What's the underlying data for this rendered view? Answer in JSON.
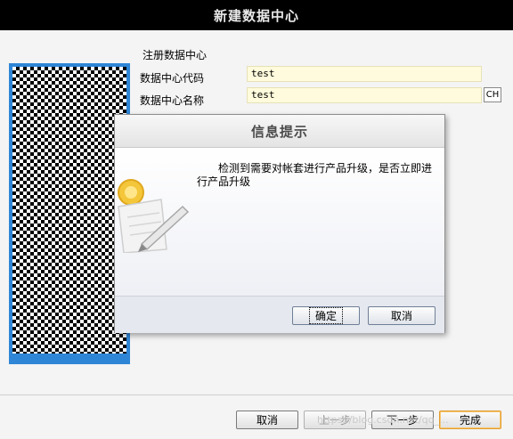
{
  "window": {
    "title": "新建数据中心"
  },
  "form": {
    "section_title": "注册数据中心",
    "code_label": "数据中心代码",
    "code_value": "test",
    "name_label": "数据中心名称",
    "name_value": "test",
    "lang_button": "CH"
  },
  "wizard": {
    "cancel": "取消",
    "prev": "上一步",
    "next": "下一步",
    "finish": "完成",
    "watermark": "https://blog.csdn.net/qq_..."
  },
  "dialog": {
    "title": "信息提示",
    "icon": "note-pencil-icon",
    "message": "检测到需要对帐套进行产品升级，是否立即进行产品升级",
    "ok": "确定",
    "cancel": "取消"
  },
  "colors": {
    "titlebar": "#000000",
    "panel_border": "#2f86d6",
    "input_bg": "#fffbdc",
    "finish_highlight": "#e39b2d"
  }
}
